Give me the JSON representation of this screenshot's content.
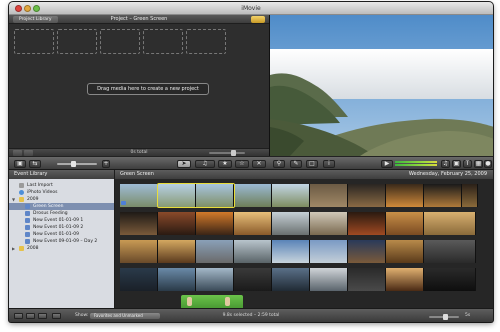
{
  "window": {
    "title": "iMovie"
  },
  "project": {
    "library_button": "Project Library",
    "title": "Project – Green Screen",
    "drop_message": "Drag media here to create a new project",
    "total": "0s total"
  },
  "event_library": {
    "header": "Event Library",
    "items": [
      {
        "label": "Last Import",
        "icon": "import-icon"
      },
      {
        "label": "iPhoto Videos",
        "icon": "iphoto-icon"
      },
      {
        "label": "2009",
        "icon": "year-folder-icon"
      },
      {
        "label": "Green Screen",
        "icon": "event-icon",
        "selected": true
      },
      {
        "label": "Drosus Feeding",
        "icon": "event-icon"
      },
      {
        "label": "New Event 01-01-09 1",
        "icon": "event-icon"
      },
      {
        "label": "New Event 01-01-09 2",
        "icon": "event-icon"
      },
      {
        "label": "New Event 01-01-09",
        "icon": "event-icon"
      },
      {
        "label": "New Event 09-01-09 – Day 2",
        "icon": "event-icon"
      },
      {
        "label": "2008",
        "icon": "year-folder-icon"
      }
    ]
  },
  "browser": {
    "title": "Green Screen",
    "date": "Wednesday, February 25, 2009"
  },
  "bottom": {
    "show_label": "Show:",
    "show_value": "Favorites and Unmarked",
    "status": "9.8s selected – 2:59 total",
    "zoom": "5s"
  },
  "colors": {
    "selection": "#e8dc3a",
    "sidebar_selected": "#7d8fb0",
    "accent_blue": "#4d7fd8"
  }
}
